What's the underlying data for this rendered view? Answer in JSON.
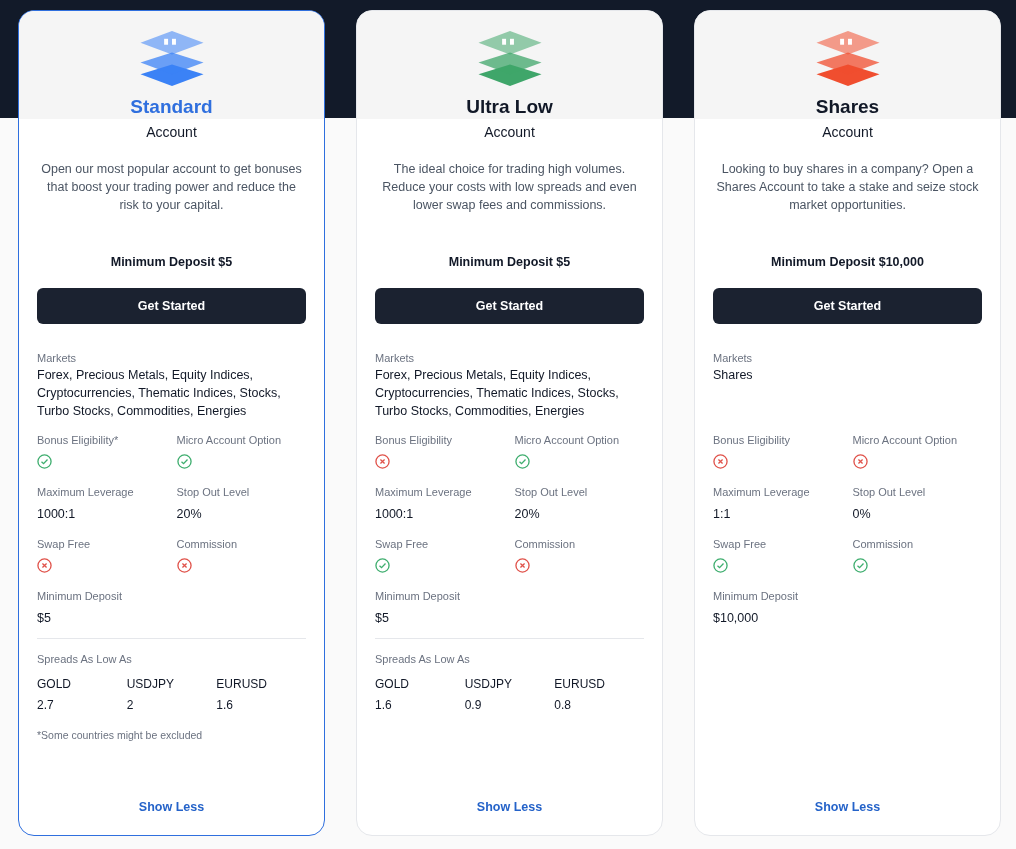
{
  "accounts": [
    {
      "name": "Standard",
      "subtitle": "Account",
      "selected": true,
      "color": "#3b82f6",
      "description": "Open our most popular account to get bonuses that boost your trading power and reduce the risk to your capital.",
      "minimum_deposit_label": "Minimum Deposit $5",
      "button": "Get Started",
      "markets_label": "Markets",
      "markets": "Forex, Precious Metals, Equity Indices, Cryptocurrencies, Thematic Indices, Stocks, Turbo Stocks, Commodities, Energies",
      "features": [
        {
          "label": "Bonus Eligibility*",
          "kind": "bool",
          "available": true
        },
        {
          "label": "Micro Account Option",
          "kind": "bool",
          "available": true
        },
        {
          "label": "Maximum Leverage",
          "kind": "text",
          "value": "1000:1"
        },
        {
          "label": "Stop Out Level",
          "kind": "text",
          "value": "20%"
        },
        {
          "label": "Swap Free",
          "kind": "bool",
          "available": false
        },
        {
          "label": "Commission",
          "kind": "bool",
          "available": false
        },
        {
          "label": "Minimum Deposit",
          "kind": "text",
          "value": "$5"
        }
      ],
      "spreads_label": "Spreads As Low As",
      "spreads": [
        {
          "symbol": "GOLD",
          "value": "2.7"
        },
        {
          "symbol": "USDJPY",
          "value": "2"
        },
        {
          "symbol": "EURUSD",
          "value": "1.6"
        }
      ],
      "footnote": "*Some countries might be excluded",
      "toggle": "Show Less"
    },
    {
      "name": "Ultra Low",
      "subtitle": "Account",
      "selected": false,
      "color": "#3fa66a",
      "description": "The ideal choice for trading high volumes. Reduce your costs with low spreads and even lower swap fees and commissions.",
      "minimum_deposit_label": "Minimum Deposit $5",
      "button": "Get Started",
      "markets_label": "Markets",
      "markets": "Forex, Precious Metals, Equity Indices, Cryptocurrencies, Thematic Indices, Stocks, Turbo Stocks, Commodities, Energies",
      "features": [
        {
          "label": "Bonus Eligibility",
          "kind": "bool",
          "available": false
        },
        {
          "label": "Micro Account Option",
          "kind": "bool",
          "available": true
        },
        {
          "label": "Maximum Leverage",
          "kind": "text",
          "value": "1000:1"
        },
        {
          "label": "Stop Out Level",
          "kind": "text",
          "value": "20%"
        },
        {
          "label": "Swap Free",
          "kind": "bool",
          "available": true
        },
        {
          "label": "Commission",
          "kind": "bool",
          "available": false
        },
        {
          "label": "Minimum Deposit",
          "kind": "text",
          "value": "$5"
        }
      ],
      "spreads_label": "Spreads As Low As",
      "spreads": [
        {
          "symbol": "GOLD",
          "value": "1.6"
        },
        {
          "symbol": "USDJPY",
          "value": "0.9"
        },
        {
          "symbol": "EURUSD",
          "value": "0.8"
        }
      ],
      "toggle": "Show Less"
    },
    {
      "name": "Shares",
      "subtitle": "Account",
      "selected": false,
      "color": "#f04e2f",
      "description": "Looking to buy shares in a company? Open a Shares Account to take a stake and seize stock market opportunities.",
      "minimum_deposit_label": "Minimum Deposit $10,000",
      "button": "Get Started",
      "markets_label": "Markets",
      "markets": "Shares",
      "features": [
        {
          "label": "Bonus Eligibility",
          "kind": "bool",
          "available": false
        },
        {
          "label": "Micro Account Option",
          "kind": "bool",
          "available": false
        },
        {
          "label": "Maximum Leverage",
          "kind": "text",
          "value": "1:1"
        },
        {
          "label": "Stop Out Level",
          "kind": "text",
          "value": "0%"
        },
        {
          "label": "Swap Free",
          "kind": "bool",
          "available": true
        },
        {
          "label": "Commission",
          "kind": "bool",
          "available": true
        },
        {
          "label": "Minimum Deposit",
          "kind": "text",
          "value": "$10,000"
        }
      ],
      "toggle": "Show Less"
    }
  ]
}
